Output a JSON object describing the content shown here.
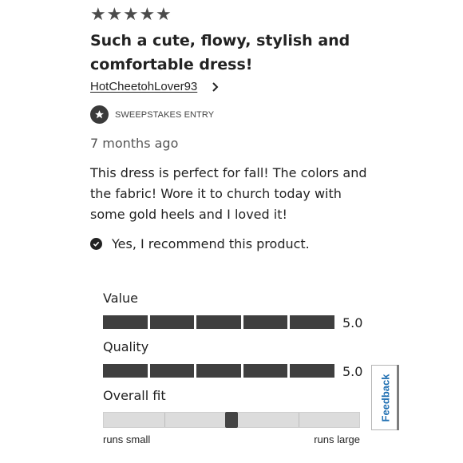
{
  "review": {
    "rating": 5,
    "rating_max": 5,
    "title": "Such a cute, flowy, stylish and comfortable dress!",
    "author": "HotCheetohLover93",
    "badge": "SWEEPSTAKES ENTRY",
    "time_ago": "7 months ago",
    "body": "This dress is perfect for fall! The colors and the fabric! Wore it to church today with some gold heels and I loved it!",
    "recommend": "Yes, I recommend this product."
  },
  "ratings": {
    "value": {
      "label": "Value",
      "score": "5.0",
      "fill_fraction": 1.0
    },
    "quality": {
      "label": "Quality",
      "score": "5.0",
      "fill_fraction": 1.0
    },
    "fit": {
      "label": "Overall fit",
      "min_label": "runs small",
      "max_label": "runs large",
      "position_fraction": 0.5
    }
  },
  "feedback_tab": {
    "label": "Feedback"
  },
  "icons": {
    "star": "star-icon",
    "chevron": "chevron-right-icon",
    "badge": "star-badge-icon",
    "recommend": "check-circle-icon"
  },
  "colors": {
    "bar_fill": "#3f3f3f",
    "fit_track": "#dcdcdc",
    "feedback_text": "#1f6fb2"
  }
}
